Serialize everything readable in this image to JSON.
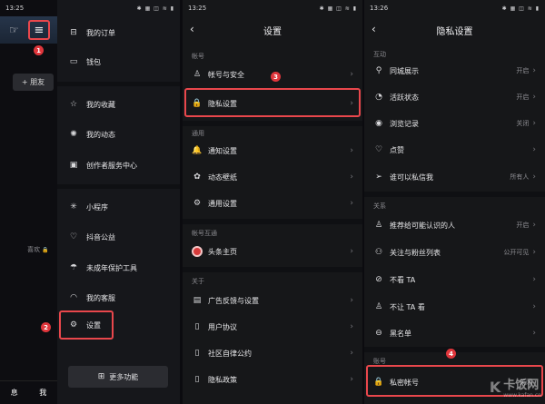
{
  "panel1": {
    "time": "13:25",
    "add_friend": "+ 朋友",
    "likes_label": "喜欢",
    "lock_glyph": "🔒",
    "bottom_nav": [
      "息",
      "我"
    ],
    "step_badge": "1"
  },
  "panel2": {
    "status_icons": "✱ ▦ ◫ ≋ ▮",
    "items": {
      "orders": "我的订单",
      "wallet": "钱包",
      "favorites": "我的收藏",
      "moments": "我的动态",
      "creator": "创作者服务中心",
      "mini": "小程序",
      "charity": "抖音公益",
      "minor": "未成年保护工具",
      "service": "我的客服",
      "settings": "设置"
    },
    "more": "更多功能",
    "step_badge": "2"
  },
  "panel3": {
    "time": "13:25",
    "title": "设置",
    "sections": {
      "account": "帐号",
      "general": "通用",
      "account_link": "帐号互通",
      "about": "关于"
    },
    "rows": {
      "security": "帐号与安全",
      "privacy": "隐私设置",
      "notify": "通知设置",
      "wallpaper": "动态壁纸",
      "common": "通用设置",
      "toutiao": "头条主页",
      "ads": "广告反馈与设置",
      "agreement": "用户协议",
      "community": "社区自律公约",
      "policy": "隐私政策"
    },
    "step_badge": "3"
  },
  "panel4": {
    "time": "13:26",
    "title": "隐私设置",
    "sections": {
      "interact": "互动",
      "relations": "关系",
      "account": "账号"
    },
    "rows": [
      {
        "label": "同城展示",
        "value": "开启"
      },
      {
        "label": "活跃状态",
        "value": "开启"
      },
      {
        "label": "浏览记录",
        "value": "关闭"
      },
      {
        "label": "点赞",
        "value": ""
      },
      {
        "label": "谁可以私信我",
        "value": "所有人"
      },
      {
        "label": "推荐给可能认识的人",
        "value": "开启"
      },
      {
        "label": "关注与粉丝列表",
        "value": "公开可见"
      },
      {
        "label": "不看 TA",
        "value": ""
      },
      {
        "label": "不让 TA 看",
        "value": ""
      },
      {
        "label": "黑名单",
        "value": ""
      },
      {
        "label": "私密帐号",
        "value": "关闭"
      }
    ],
    "step_badge": "4"
  },
  "watermark": {
    "brand": "卡饭网",
    "url": "www.kafan.cn"
  },
  "colors": {
    "highlight": "#e9474c",
    "badge": "#e0363c"
  }
}
